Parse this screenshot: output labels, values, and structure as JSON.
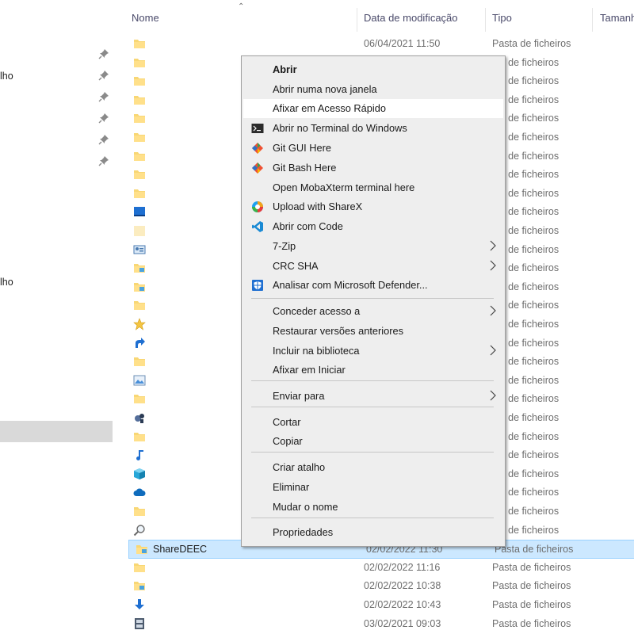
{
  "header": {
    "col_name": "Nome",
    "col_date": "Data de modificação",
    "col_type": "Tipo",
    "col_size": "Tamanh"
  },
  "nav": {
    "items": [
      {
        "label": "lho"
      },
      {
        "label": "lho"
      }
    ]
  },
  "rows": [
    {
      "icon": "folder-icon",
      "date": "06/04/2021 11:50",
      "type": "Pasta de ficheiros"
    },
    {
      "icon": "folder-icon",
      "date": "",
      "type": "sta de ficheiros"
    },
    {
      "icon": "folder-icon",
      "date": "",
      "type": "sta de ficheiros"
    },
    {
      "icon": "folder-icon",
      "date": "",
      "type": "sta de ficheiros"
    },
    {
      "icon": "folder-icon",
      "date": "",
      "type": "sta de ficheiros"
    },
    {
      "icon": "folder-icon",
      "date": "",
      "type": "sta de ficheiros"
    },
    {
      "icon": "folder-icon",
      "date": "",
      "type": "sta de ficheiros"
    },
    {
      "icon": "folder-icon",
      "date": "",
      "type": "sta de ficheiros"
    },
    {
      "icon": "folder-icon",
      "date": "",
      "type": "sta de ficheiros"
    },
    {
      "icon": "desktop-folder-icon",
      "date": "",
      "type": "sta de ficheiros"
    },
    {
      "icon": "blank-folder-icon",
      "date": "",
      "type": "sta de ficheiros"
    },
    {
      "icon": "contacts-folder-icon",
      "date": "",
      "type": "sta de ficheiros"
    },
    {
      "icon": "documents-folder-icon",
      "date": "",
      "type": "sta de ficheiros"
    },
    {
      "icon": "documents-folder-icon",
      "date": "",
      "type": "sta de ficheiros"
    },
    {
      "icon": "folder-icon",
      "date": "",
      "type": "sta de ficheiros"
    },
    {
      "icon": "favorites-star-icon",
      "date": "",
      "type": "sta de ficheiros"
    },
    {
      "icon": "links-arrow-icon",
      "date": "",
      "type": "sta de ficheiros"
    },
    {
      "icon": "folder-icon",
      "date": "",
      "type": "sta de ficheiros"
    },
    {
      "icon": "pictures-folder-icon",
      "date": "",
      "type": "sta de ficheiros"
    },
    {
      "icon": "folder-icon",
      "date": "",
      "type": "sta de ficheiros"
    },
    {
      "icon": "games-folder-icon",
      "date": "",
      "type": "sta de ficheiros"
    },
    {
      "icon": "folder-icon",
      "date": "",
      "type": "sta de ficheiros"
    },
    {
      "icon": "music-note-icon",
      "date": "",
      "type": "sta de ficheiros"
    },
    {
      "icon": "3d-objects-icon",
      "date": "",
      "type": "sta de ficheiros"
    },
    {
      "icon": "onedrive-cloud-icon",
      "date": "",
      "type": "sta de ficheiros"
    },
    {
      "icon": "folder-icon",
      "date": "",
      "type": "sta de ficheiros"
    },
    {
      "icon": "searches-magnifier-icon",
      "date": "",
      "type": "sta de ficheiros"
    },
    {
      "icon": "documents-folder-icon",
      "name": "ShareDEEC",
      "date": "02/02/2022 11:30",
      "type": "Pasta de ficheiros",
      "selected": true
    },
    {
      "icon": "folder-icon",
      "date": "02/02/2022 11:16",
      "type": "Pasta de ficheiros"
    },
    {
      "icon": "documents-folder-icon",
      "date": "02/02/2022 10:38",
      "type": "Pasta de ficheiros"
    },
    {
      "icon": "downloads-arrow-icon",
      "date": "02/02/2022 10:43",
      "type": "Pasta de ficheiros"
    },
    {
      "icon": "videos-film-icon",
      "date": "03/02/2021 09:03",
      "type": "Pasta de ficheiros"
    }
  ],
  "menu": {
    "items": [
      {
        "label": "Abrir",
        "bold": true
      },
      {
        "label": "Abrir numa nova janela"
      },
      {
        "label": "Afixar em Acesso Rápido",
        "hover": true
      },
      {
        "label": "Abrir no Terminal do Windows",
        "icon": "terminal-icon"
      },
      {
        "label": "Git GUI Here",
        "icon": "git-icon"
      },
      {
        "label": "Git Bash Here",
        "icon": "git-icon"
      },
      {
        "label": "Open MobaXterm terminal here"
      },
      {
        "label": "Upload with ShareX",
        "icon": "sharex-icon"
      },
      {
        "label": "Abrir com Code",
        "icon": "vscode-icon"
      },
      {
        "label": "7-Zip",
        "submenu": true
      },
      {
        "label": "CRC SHA",
        "submenu": true
      },
      {
        "label": "Analisar com Microsoft Defender...",
        "icon": "defender-shield-icon"
      },
      {
        "label": "Conceder acesso a",
        "submenu": true
      },
      {
        "label": "Restaurar versões anteriores"
      },
      {
        "label": "Incluir na biblioteca",
        "submenu": true
      },
      {
        "label": "Afixar em Iniciar"
      },
      {
        "label": "Enviar para",
        "submenu": true
      },
      {
        "label": "Cortar"
      },
      {
        "label": "Copiar"
      },
      {
        "label": "Criar atalho"
      },
      {
        "label": "Eliminar"
      },
      {
        "label": "Mudar o nome"
      },
      {
        "label": "Propriedades"
      }
    ]
  }
}
